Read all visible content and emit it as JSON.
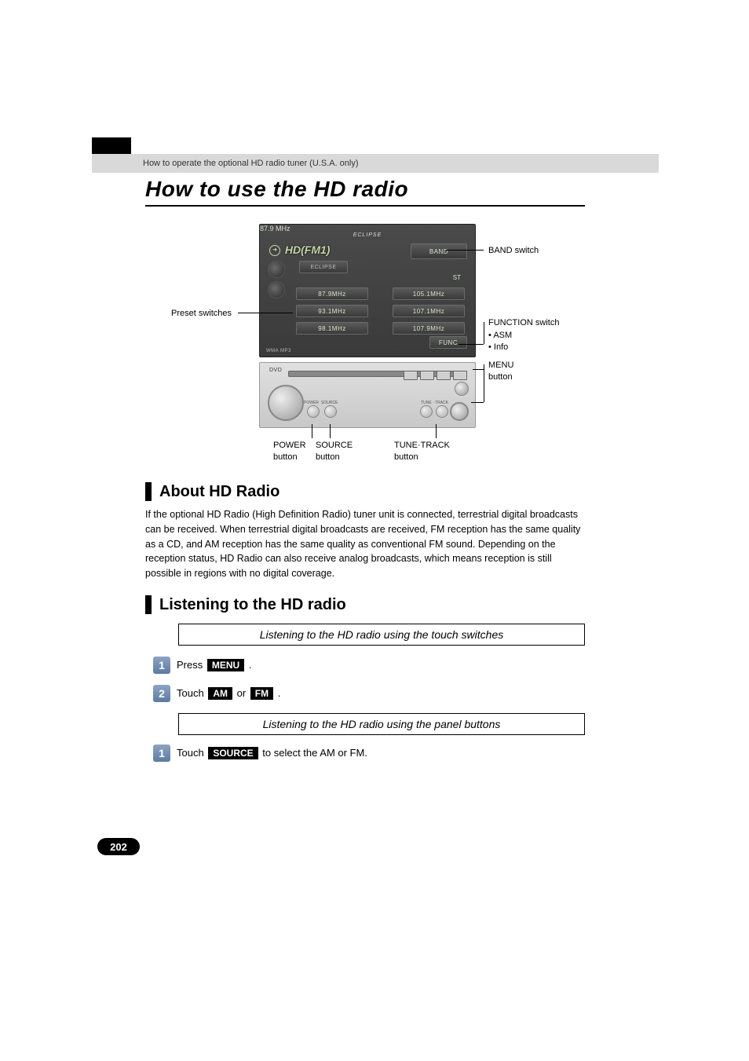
{
  "header": {
    "breadcrumb": "How to operate the optional HD radio tuner (U.S.A. only)"
  },
  "title": "How to use the HD radio",
  "figure": {
    "brand": "ECLIPSE",
    "mode": "HD(FM1)",
    "sub_label": "ECLIPSE",
    "band_btn": "BAND",
    "freq_main": "87.9 MHz",
    "st": "ST",
    "presets_left": [
      "87.9MHz",
      "93.1MHz",
      "98.1MHz"
    ],
    "presets_right": [
      "105.1MHz",
      "107.1MHz",
      "107.9MHz"
    ],
    "func_btn": "FUNC",
    "dvd": "DVD",
    "info_row": "WMA  MP3",
    "callouts": {
      "preset": "Preset switches",
      "band": "BAND switch",
      "func_title": "FUNCTION switch",
      "func_items": [
        "ASM",
        "Info"
      ],
      "menu": "MENU\nbutton",
      "power": "POWER\nbutton",
      "source": "SOURCE\nbutton",
      "tune": "TUNE·TRACK\nbutton"
    }
  },
  "sections": {
    "about": {
      "title": "About HD Radio",
      "body": "If the optional HD Radio (High Definition Radio) tuner unit is connected, terrestrial digital broadcasts can be received. When terrestrial digital broadcasts are received, FM reception has the same quality as a CD, and AM reception has the same quality as conventional FM sound. Depending on the reception status, HD Radio can also receive analog broadcasts, which means reception is still possible in regions with no digital coverage."
    },
    "listen": {
      "title": "Listening to the HD radio",
      "sub1": "Listening to  the HD radio using the touch switches",
      "step1_prefix": "Press ",
      "step1_btn": "MENU",
      "step1_suffix": " .",
      "step2_prefix": "Touch ",
      "step2_btn1": "AM",
      "step2_mid": " or ",
      "step2_btn2": "FM",
      "step2_suffix": " .",
      "sub2": "Listening to the HD radio using the panel buttons",
      "stepB1_prefix": "Touch ",
      "stepB1_btn": "SOURCE",
      "stepB1_suffix": " to select the AM or FM."
    }
  },
  "page_number": "202"
}
